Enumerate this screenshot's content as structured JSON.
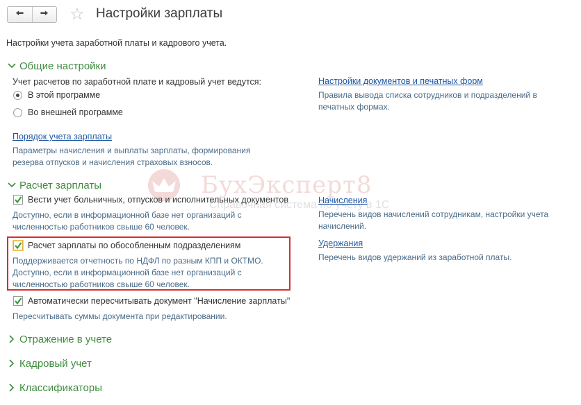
{
  "header": {
    "back_icon": "arrow-left-icon",
    "forward_icon": "arrow-right-icon",
    "favorite_icon": "star-icon",
    "title": "Настройки зарплаты"
  },
  "subtitle": "Настройки учета заработной платы и кадрового учета.",
  "sections": {
    "general": {
      "title": "Общие настройки",
      "question": "Учет расчетов по заработной плате и кадровый учет ведутся:",
      "options": [
        "В этой программе",
        "Во внешней программе"
      ],
      "selected_option": "В этой программе",
      "order_link": "Порядок учета зарплаты",
      "order_desc": [
        "Параметры начисления и выплаты зарплаты, формирования",
        "резерва отпусков и начисления страховых взносов."
      ],
      "docs_link": "Настройки документов и печатных форм",
      "docs_desc": [
        "Правила вывода списка сотрудников и подразделений в",
        "печатных формах."
      ]
    },
    "payroll": {
      "title": "Расчет зарплаты",
      "cb1": {
        "label": "Вести учет больничных, отпусков и исполнительных документов",
        "checked": true,
        "desc": [
          "Доступно, если в информационной базе нет организаций с",
          "численностью работников свыше 60 человек."
        ]
      },
      "cb2": {
        "label": "Расчет зарплаты по обособленным подразделениям",
        "checked": true,
        "desc": [
          "Поддерживается отчетность по НДФЛ по разным КПП и ОКТМО.",
          "Доступно, если в информационной базе нет организаций с",
          "численностью работников свыше 60 человек."
        ]
      },
      "cb3": {
        "label": "Автоматически пересчитывать документ \"Начисление зарплаты\"",
        "checked": true,
        "desc": [
          "Пересчитывать суммы документа при редактировании."
        ]
      },
      "accruals_link": "Начисления",
      "accruals_desc": [
        "Перечень видов начислений сотрудникам, настройки учета",
        "начислений."
      ],
      "deductions_link": "Удержания",
      "deductions_desc": [
        "Перечень видов удержаний из заработной платы."
      ]
    },
    "collapsed": [
      "Отражение в учете",
      "Кадровый учет",
      "Классификаторы"
    ]
  },
  "watermark": {
    "brand": "БухЭксперт8",
    "tagline": "Справочная система по учету в 1С"
  },
  "colors": {
    "section_green": "#3e8b3e",
    "link_blue": "#1f57a4",
    "highlight_red": "#d92b2b"
  }
}
